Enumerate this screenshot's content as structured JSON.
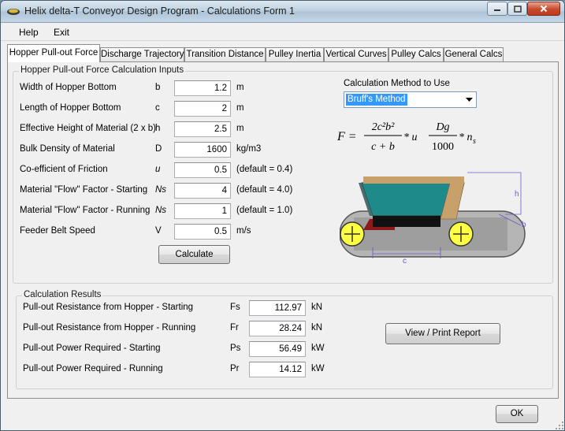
{
  "window": {
    "title": "Helix delta-T Conveyor Design Program - Calculations Form 1"
  },
  "menu": {
    "help": "Help",
    "exit": "Exit"
  },
  "tabs": [
    {
      "label": "Hopper Pull-out Force"
    },
    {
      "label": "Discharge Trajectory"
    },
    {
      "label": "Transition Distance"
    },
    {
      "label": "Pulley Inertia"
    },
    {
      "label": "Vertical Curves"
    },
    {
      "label": "Pulley Calcs"
    },
    {
      "label": "General Calcs"
    }
  ],
  "inputs": {
    "group_title": "Hopper Pull-out Force Calculation Inputs",
    "rows": [
      {
        "label": "Width of Hopper Bottom",
        "symbol": "b",
        "value": "1.2",
        "unit": "m"
      },
      {
        "label": "Length of Hopper Bottom",
        "symbol": "c",
        "value": "2",
        "unit": "m"
      },
      {
        "label": "Effective Height of Material (2 x b)",
        "symbol": "h",
        "value": "2.5",
        "unit": "m"
      },
      {
        "label": "Bulk Density of Material",
        "symbol": "D",
        "value": "1600",
        "unit": "kg/m3"
      },
      {
        "label": "Co-efficient of Friction",
        "symbol": "u",
        "value": "0.5",
        "unit": "(default = 0.4)"
      },
      {
        "label": "Material \"Flow\" Factor - Starting",
        "symbol": "Ns",
        "value": "4",
        "unit": "(default = 4.0)"
      },
      {
        "label": "Material \"Flow\" Factor - Running",
        "symbol": "Ns",
        "value": "1",
        "unit": "(default = 1.0)"
      },
      {
        "label": "Feeder Belt Speed",
        "symbol": "V",
        "value": "0.5",
        "unit": "m/s"
      }
    ],
    "calculate_label": "Calculate",
    "method_label": "Calculation Method to Use",
    "method_selected": "Bruff's Method"
  },
  "formula": {
    "lhs": "F =",
    "num1": "2c²b²",
    "den1": "c + b",
    "times1": "* u",
    "num2": "Dg",
    "den2": "1000",
    "times2": "* n",
    "sub2": "s"
  },
  "diagram": {
    "label_h": "h",
    "label_b": "b",
    "label_c": "c"
  },
  "results": {
    "group_title": "Calculation Results",
    "rows": [
      {
        "label": "Pull-out Resistance from Hopper - Starting",
        "symbol": "Fs",
        "value": "112.97",
        "unit": "kN"
      },
      {
        "label": "Pull-out Resistance from Hopper - Running",
        "symbol": "Fr",
        "value": "28.24",
        "unit": "kN"
      },
      {
        "label": "Pull-out Power Required - Starting",
        "symbol": "Ps",
        "value": "56.49",
        "unit": "kW"
      },
      {
        "label": "Pull-out Power Required - Running",
        "symbol": "Pr",
        "value": "14.12",
        "unit": "kW"
      }
    ],
    "report_label": "View / Print Report"
  },
  "ok_label": "OK",
  "colors": {
    "hopper": "#1f8a8a",
    "material": "#c8a06a",
    "belt": "#b5b5b5",
    "pulley": "#ffff44",
    "accent": "#3399ff"
  }
}
